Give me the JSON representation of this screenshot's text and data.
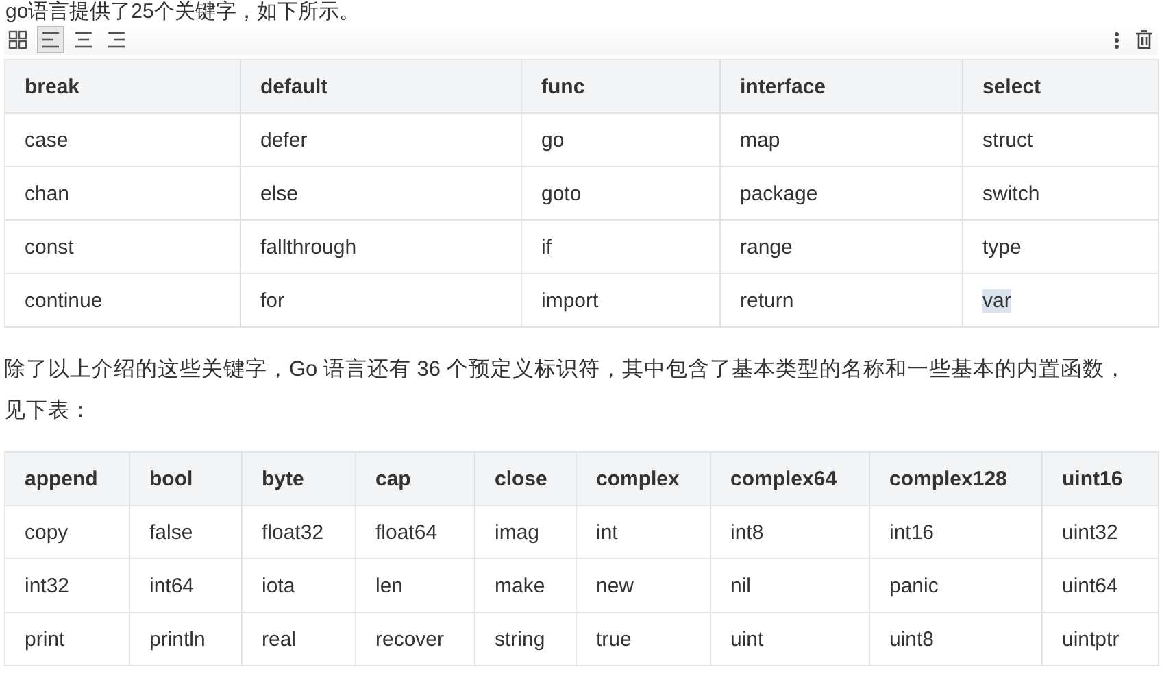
{
  "intro": "go语言提供了25个关键字，如下所示。",
  "toolbar": {
    "layouts": [
      {
        "kind": "grid",
        "selected": false
      },
      {
        "kind": "align-left",
        "selected": true
      },
      {
        "kind": "align-center",
        "selected": false
      },
      {
        "kind": "align-right",
        "selected": false
      }
    ],
    "actions": [
      {
        "kind": "more"
      },
      {
        "kind": "delete"
      }
    ]
  },
  "keywords_table": {
    "columns": [
      "break",
      "default",
      "func",
      "interface",
      "select"
    ],
    "rows": [
      [
        {
          "text": "case",
          "selected": false
        },
        {
          "text": "defer",
          "selected": false
        },
        {
          "text": "go",
          "selected": false
        },
        {
          "text": "map",
          "selected": false
        },
        {
          "text": "struct",
          "selected": false
        }
      ],
      [
        {
          "text": "chan",
          "selected": false
        },
        {
          "text": "else",
          "selected": false
        },
        {
          "text": "goto",
          "selected": false
        },
        {
          "text": "package",
          "selected": false
        },
        {
          "text": "switch",
          "selected": false
        }
      ],
      [
        {
          "text": "const",
          "selected": false
        },
        {
          "text": "fallthrough",
          "selected": false
        },
        {
          "text": "if",
          "selected": false
        },
        {
          "text": "range",
          "selected": false
        },
        {
          "text": "type",
          "selected": false
        }
      ],
      [
        {
          "text": "continue",
          "selected": false
        },
        {
          "text": "for",
          "selected": false
        },
        {
          "text": "import",
          "selected": false
        },
        {
          "text": "return",
          "selected": false
        },
        {
          "text": "var",
          "selected": true
        }
      ]
    ]
  },
  "paragraph": "除了以上介绍的这些关键字，Go 语言还有 36 个预定义标识符，其中包含了基本类型的名称和一些基本的内置函数，见下表：",
  "identifiers_table": {
    "columns": [
      "append",
      "bool",
      "byte",
      "cap",
      "close",
      "complex",
      "complex64",
      "complex128",
      "uint16"
    ],
    "rows": [
      [
        "copy",
        "false",
        "float32",
        "float64",
        "imag",
        "int",
        "int8",
        "int16",
        "uint32"
      ],
      [
        "int32",
        "int64",
        "iota",
        "len",
        "make",
        "new",
        "nil",
        "panic",
        "uint64"
      ],
      [
        "print",
        "println",
        "real",
        "recover",
        "string",
        "true",
        "uint",
        "uint8",
        "uintptr"
      ]
    ]
  }
}
